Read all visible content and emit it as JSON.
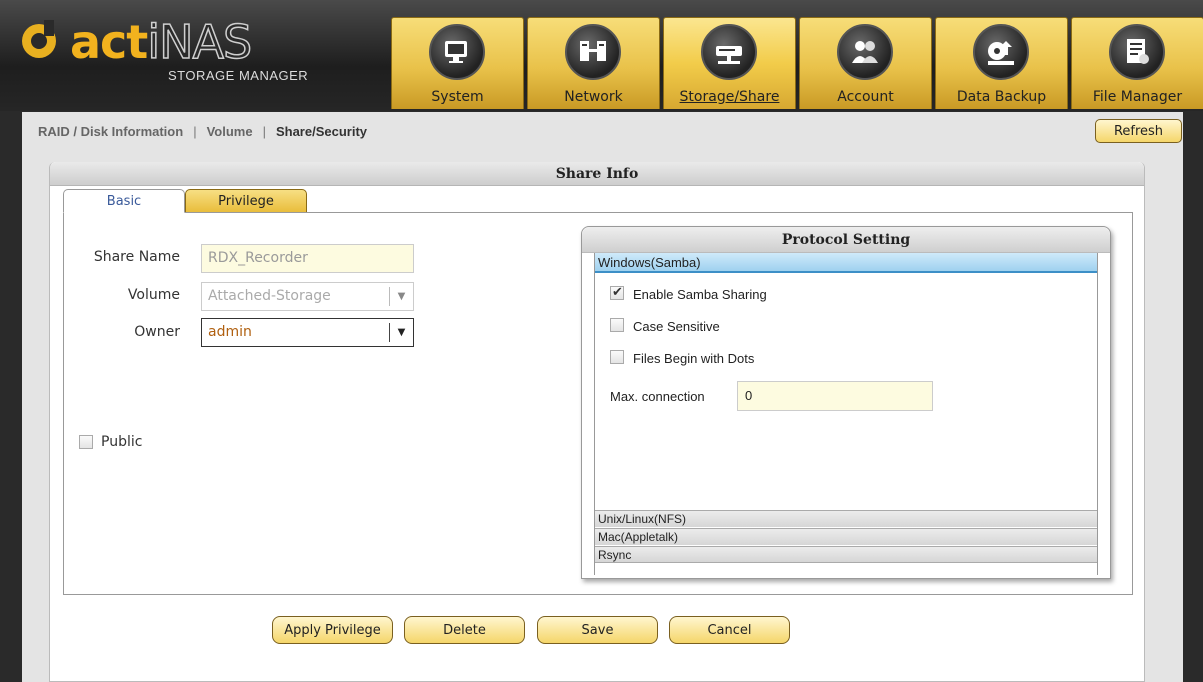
{
  "app": {
    "logo_main_a": "act",
    "logo_main_b": "iNAS",
    "logo_sub": "STORAGE MANAGER"
  },
  "nav": {
    "tabs": [
      {
        "label": "System",
        "icon": "monitor-icon"
      },
      {
        "label": "Network",
        "icon": "network-icon"
      },
      {
        "label": "Storage/Share",
        "icon": "storage-icon",
        "active": true
      },
      {
        "label": "Account",
        "icon": "users-icon"
      },
      {
        "label": "Data Backup",
        "icon": "backup-icon"
      },
      {
        "label": "File Manager",
        "icon": "file-manager-icon"
      }
    ]
  },
  "breadcrumb": {
    "items": [
      "RAID / Disk Information",
      "Volume",
      "Share/Security"
    ],
    "separator": "|"
  },
  "toolbar": {
    "refresh_label": "Refresh"
  },
  "share_info": {
    "title": "Share Info",
    "tabs": {
      "basic": "Basic",
      "privilege": "Privilege"
    },
    "share_name_label": "Share Name",
    "share_name_value": "RDX_Recorder",
    "volume_label": "Volume",
    "volume_value": "Attached-Storage",
    "owner_label": "Owner",
    "owner_value": "admin",
    "public_label": "Public"
  },
  "protocol": {
    "title": "Protocol Setting",
    "sections": [
      "Windows(Samba)",
      "Unix/Linux(NFS)",
      "Mac(Appletalk)",
      "Rsync"
    ],
    "enable_samba_label": "Enable Samba Sharing",
    "enable_samba_checked": true,
    "case_sensitive_label": "Case Sensitive",
    "case_sensitive_checked": false,
    "files_dots_label": "Files Begin with Dots",
    "files_dots_checked": false,
    "max_connection_label": "Max. connection",
    "max_connection_value": "0"
  },
  "actions": {
    "apply_privilege": "Apply Privilege",
    "delete": "Delete",
    "save": "Save",
    "cancel": "Cancel"
  },
  "colors": {
    "accent_gold": "#f2b21e",
    "tab_gold": "#e9c24a",
    "samba_header_blue": "#9fd1ef"
  }
}
